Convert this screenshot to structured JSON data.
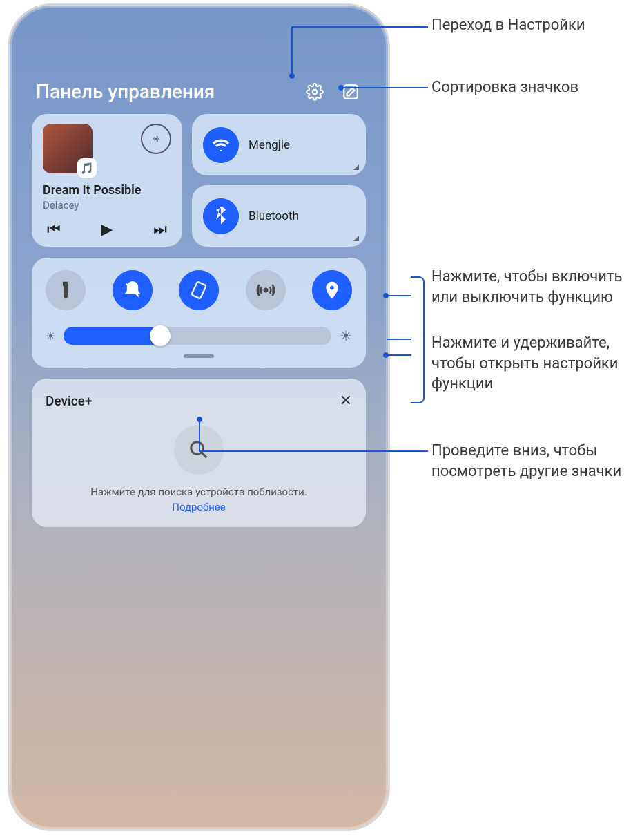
{
  "header": {
    "title": "Панель управления"
  },
  "music": {
    "track": "Dream It Possible",
    "artist": "Delacey"
  },
  "wifi": {
    "label": "Mengjie"
  },
  "bluetooth": {
    "label": "Bluetooth"
  },
  "device": {
    "title": "Device+",
    "hint": "Нажмите для поиска устройств поблизости.",
    "link": "Подробнее"
  },
  "callouts": {
    "settings": "Переход в Настройки",
    "sort": "Сортировка значков",
    "tap": "Нажмите, чтобы включить или выключить функцию",
    "hold": "Нажмите и удерживайте, чтобы открыть настройки функции",
    "swipe": "Проведите вниз, чтобы посмотреть другие значки"
  }
}
